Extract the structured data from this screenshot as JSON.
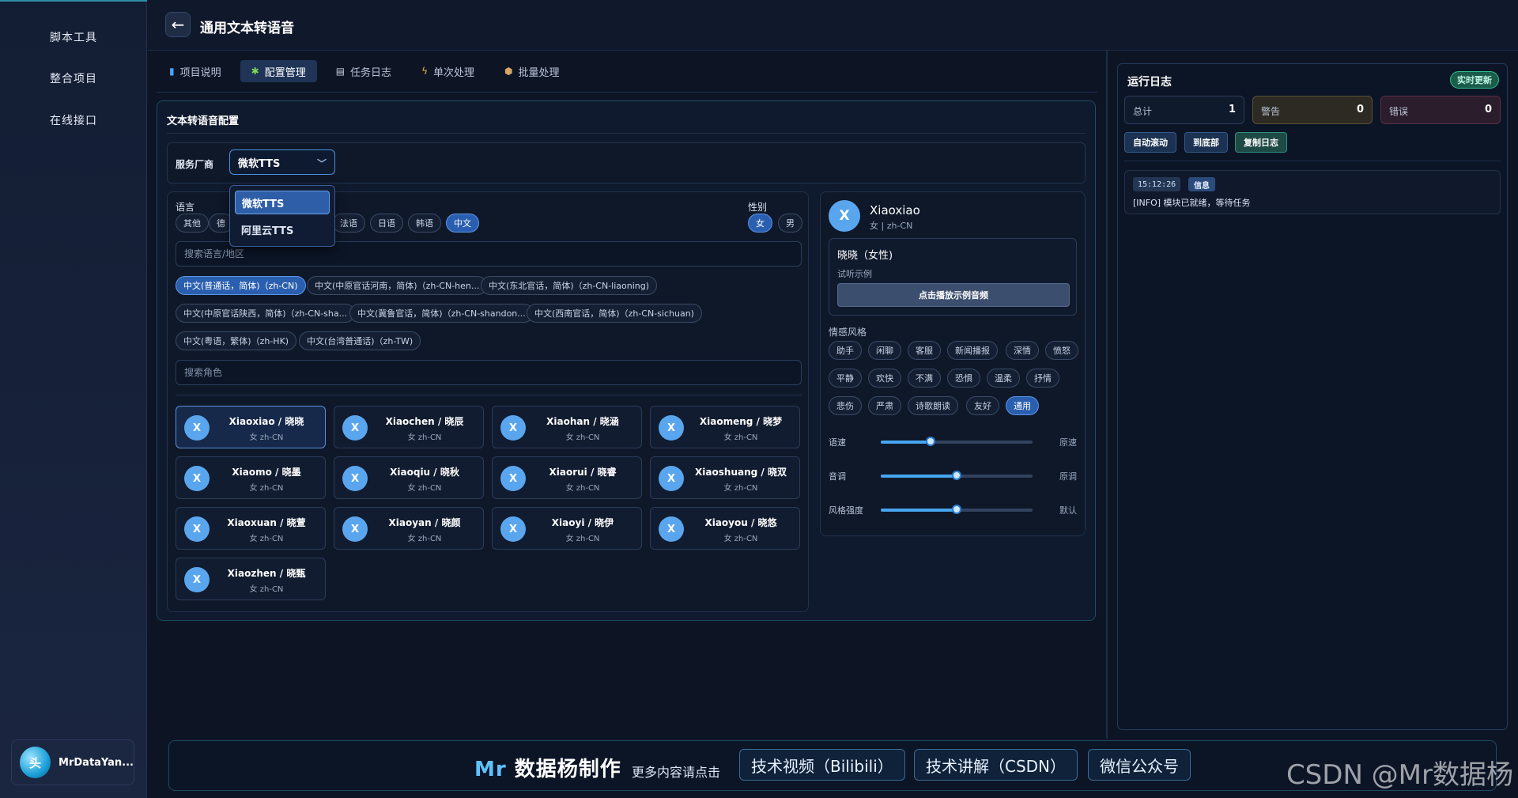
{
  "sidebar": {
    "items": [
      {
        "label": "脚本工具"
      },
      {
        "label": "整合项目"
      },
      {
        "label": "在线接口"
      }
    ],
    "user": {
      "avatar_text": "头",
      "name": "MrDataYan..."
    }
  },
  "header": {
    "back_icon": "←",
    "title": "通用文本转语音"
  },
  "tabs": [
    {
      "label": "项目说明",
      "icon": "book-icon"
    },
    {
      "label": "配置管理",
      "icon": "puzzle-icon"
    },
    {
      "label": "任务日志",
      "icon": "doc-icon"
    },
    {
      "label": "单次处理",
      "icon": "bolt-icon"
    },
    {
      "label": "批量处理",
      "icon": "box-icon"
    }
  ],
  "config": {
    "title": "文本转语音配置",
    "vendor": {
      "label": "服务厂商",
      "value": "微软TTS",
      "options": [
        "微软TTS",
        "阿里云TTS"
      ]
    },
    "language": {
      "label": "语言",
      "chips": [
        "其他",
        "德",
        "法语",
        "日语",
        "韩语",
        "中文"
      ],
      "search_placeholder": "搜索语言/地区"
    },
    "gender": {
      "label": "性别",
      "options": [
        "女",
        "男"
      ]
    },
    "locales": [
      "中文(普通话，简体)（zh-CN)",
      "中文(中原官话河南，简体)（zh-CN-hen...",
      "中文(东北官话，简体)（zh-CN-liaoning)",
      "中文(中原官话陕西，简体)（zh-CN-sha...",
      "中文(冀鲁官话，简体)（zh-CN-shandon...",
      "中文(西南官话，简体)（zh-CN-sichuan)",
      "中文(粤语，繁体)（zh-HK)",
      "中文(台湾普通话)（zh-TW)"
    ],
    "role_search_placeholder": "搜索角色",
    "voices": [
      {
        "name": "Xiaoxiao / 晓晓",
        "sub": "女 zh-CN",
        "initial": "X"
      },
      {
        "name": "Xiaochen / 晓辰",
        "sub": "女 zh-CN",
        "initial": "X"
      },
      {
        "name": "Xiaohan / 晓涵",
        "sub": "女 zh-CN",
        "initial": "X"
      },
      {
        "name": "Xiaomeng / 晓梦",
        "sub": "女 zh-CN",
        "initial": "X"
      },
      {
        "name": "Xiaomo / 晓墨",
        "sub": "女 zh-CN",
        "initial": "X"
      },
      {
        "name": "Xiaoqiu / 晓秋",
        "sub": "女 zh-CN",
        "initial": "X"
      },
      {
        "name": "Xiaorui / 晓睿",
        "sub": "女 zh-CN",
        "initial": "X"
      },
      {
        "name": "Xiaoshuang / 晓双",
        "sub": "女 zh-CN",
        "initial": "X"
      },
      {
        "name": "Xiaoxuan / 晓萱",
        "sub": "女 zh-CN",
        "initial": "X"
      },
      {
        "name": "Xiaoyan / 晓颜",
        "sub": "女 zh-CN",
        "initial": "X"
      },
      {
        "name": "Xiaoyi / 晓伊",
        "sub": "女 zh-CN",
        "initial": "X"
      },
      {
        "name": "Xiaoyou / 晓悠",
        "sub": "女 zh-CN",
        "initial": "X"
      },
      {
        "name": "Xiaozhen / 晓甄",
        "sub": "女 zh-CN",
        "initial": "X"
      }
    ]
  },
  "preview": {
    "initial": "X",
    "name": "Xiaoxiao",
    "sub": "女 | zh-CN",
    "display_name": "晓晓（女性)",
    "sample_label": "试听示例",
    "play_button": "点击播放示例音频",
    "emotion_label": "情感风格",
    "emotions": [
      "助手",
      "闲聊",
      "客服",
      "新闻播报",
      "深情",
      "愤怒",
      "平静",
      "欢快",
      "不满",
      "恐惧",
      "温柔",
      "抒情",
      "悲伤",
      "严肃",
      "诗歌朗读",
      "友好",
      "通用"
    ],
    "sliders": [
      {
        "label": "语速",
        "value_text": "原速",
        "level": 0.33
      },
      {
        "label": "音调",
        "value_text": "原调",
        "level": 0.5
      },
      {
        "label": "风格强度",
        "value_text": "默认",
        "level": 0.5
      }
    ]
  },
  "log": {
    "title": "运行日志",
    "live_badge": "实时更新",
    "stats": [
      {
        "label": "总计",
        "value": "1"
      },
      {
        "label": "警告",
        "value": "0"
      },
      {
        "label": "错误",
        "value": "0"
      }
    ],
    "buttons": [
      "自动滚动",
      "到底部",
      "复制日志"
    ],
    "entries": [
      {
        "time": "15:12:26",
        "level": "信息",
        "message": "[INFO] 模块已就绪，等待任务"
      }
    ]
  },
  "footer": {
    "brand_mr": "Mr",
    "brand_rest": " 数据杨制作",
    "more": "更多内容请点击",
    "links": [
      "技术视频（Bilibili）",
      "技术讲解（CSDN）",
      "微信公众号"
    ]
  },
  "watermark": "CSDN @Mr数据杨"
}
